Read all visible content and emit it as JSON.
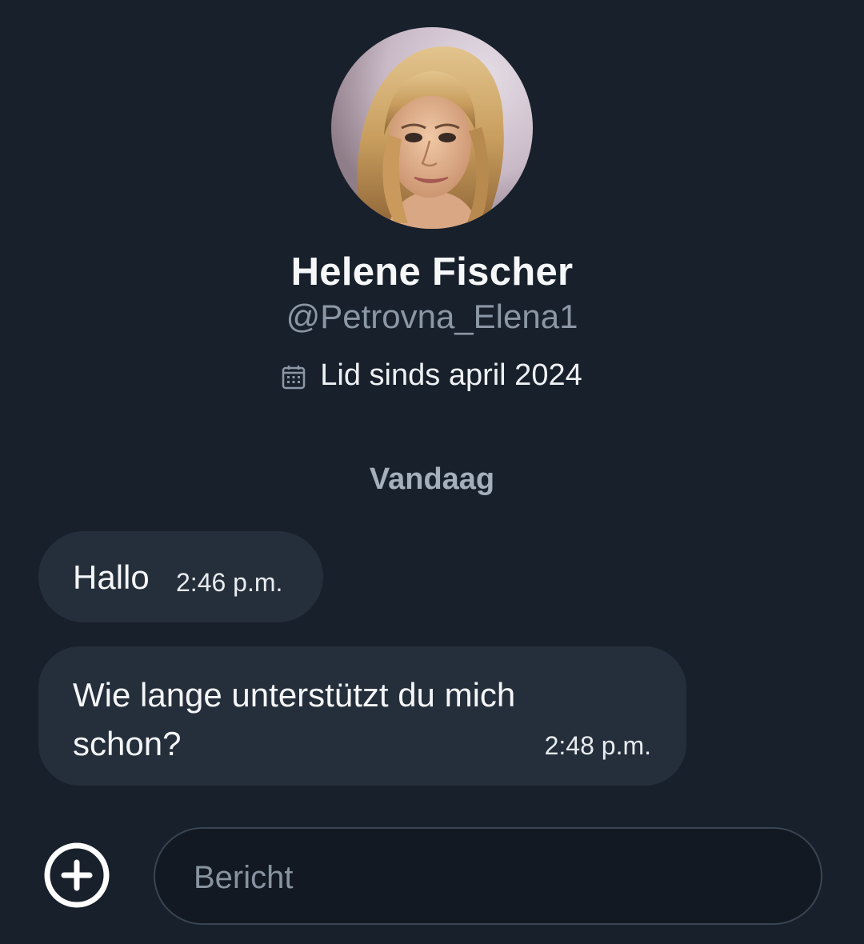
{
  "profile": {
    "name": "Helene Fischer",
    "handle": "@Petrovna_Elena1",
    "joined": "Lid sinds april 2024",
    "joined_icon": "calendar-icon"
  },
  "conversation": {
    "day_label": "Vandaag",
    "messages": [
      {
        "text": "Hallo",
        "time": "2:46 p.m."
      },
      {
        "text": "Wie lange unterstützt du mich schon?",
        "time": "2:48 p.m."
      }
    ]
  },
  "composer": {
    "placeholder": "Bericht",
    "add_icon": "plus-circle-icon"
  },
  "colors": {
    "background": "#18202b",
    "bubble": "#252f3b",
    "secondary_text": "#8b97a4"
  }
}
